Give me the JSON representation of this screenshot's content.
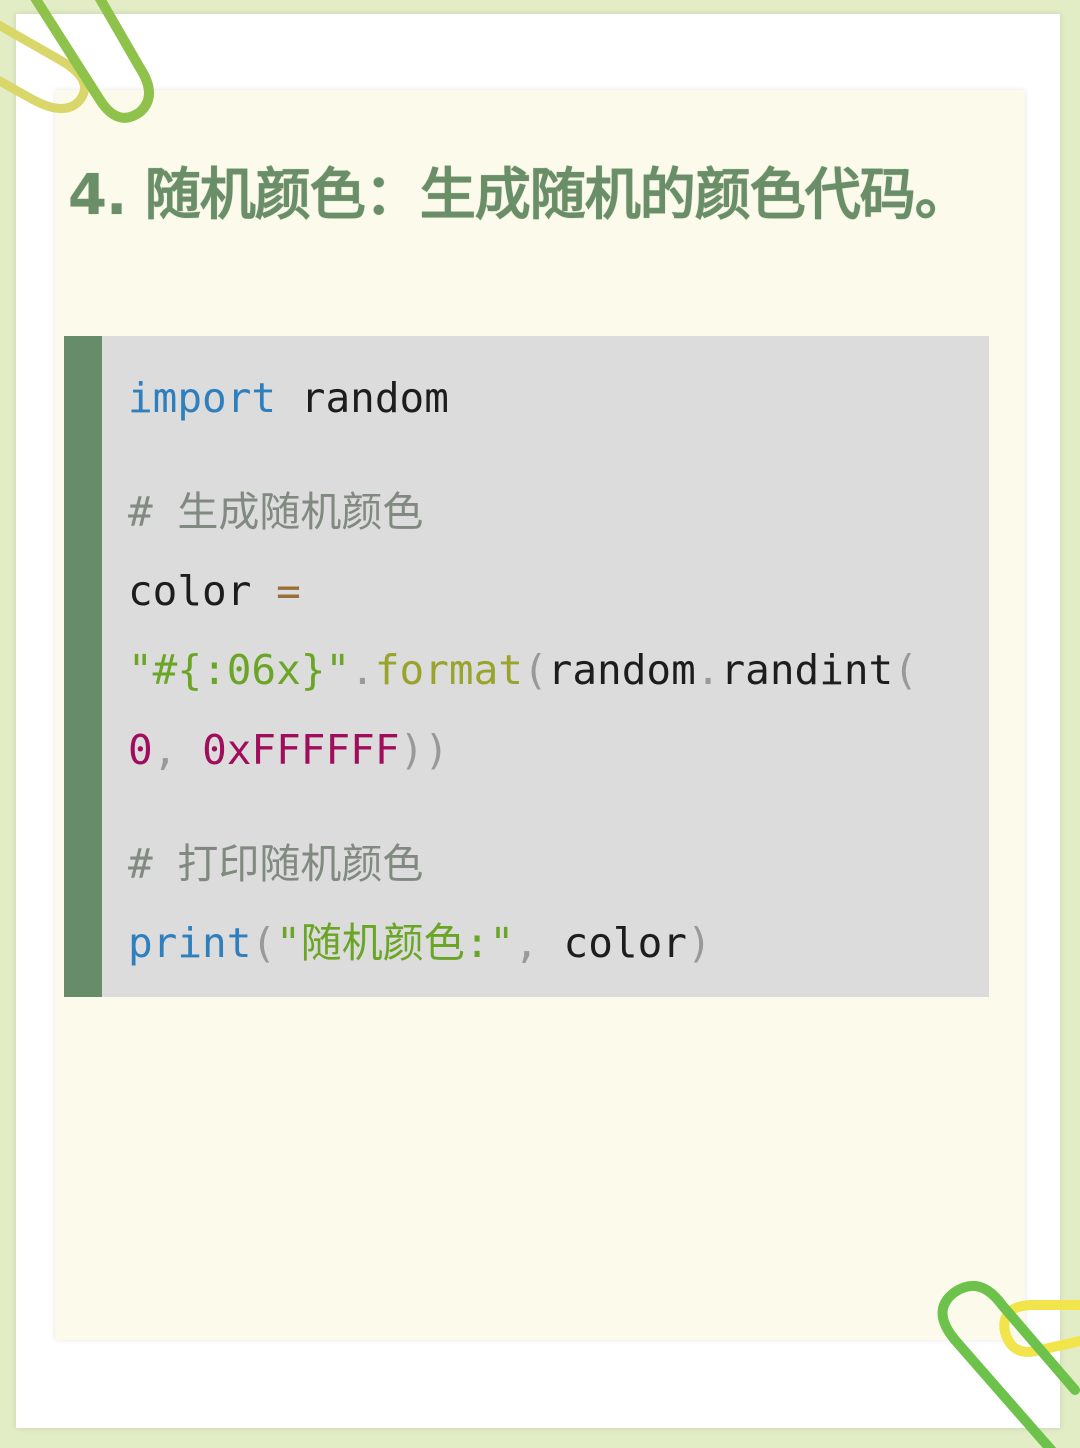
{
  "heading": "4. 随机颜色：生成随机的颜色代码。",
  "code": {
    "import_kw": "import",
    "import_mod": " random",
    "comment_generate": "# 生成随机颜色",
    "assign_var": "color ",
    "assign_op": "=",
    "format_str": "\"#{:06x}\"",
    "dot1": ".",
    "format_fn": "format",
    "paren_open1": "(",
    "random_mod": "random",
    "dot2": ".",
    "randint_fn": "randint",
    "paren_open2": "(",
    "num_zero": "0",
    "comma1": ", ",
    "num_hex": "0xFFFFFF",
    "paren_close": "))",
    "comment_print": "# 打印随机颜色",
    "print_kw": "print",
    "paren_open3": "(",
    "print_str": "\"随机颜色:\"",
    "comma2": ", ",
    "print_var": "color",
    "paren_close3": ")"
  },
  "colors": {
    "page_background": "#e2edc6",
    "card_background": "#fbfaeb",
    "heading_color": "#6a8f68",
    "code_background": "#dcdcdc",
    "code_bar": "#678c6a",
    "keyword": "#2f7fbd",
    "string": "#6aa526",
    "number": "#a00d5c",
    "comment": "#808a80"
  },
  "decorations": {
    "top_left_clip": "paperclip-icon",
    "bottom_right_clip": "paperclip-icon"
  }
}
